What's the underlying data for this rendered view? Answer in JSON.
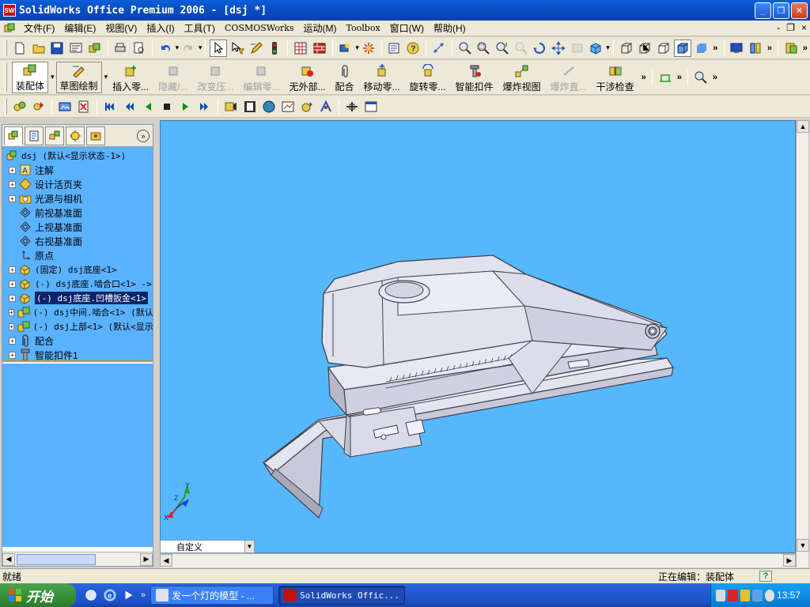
{
  "window": {
    "title": "SolidWorks Office Premium 2006 - [dsj *]",
    "buttons": {
      "minimize": "_",
      "restore": "❐",
      "close": "✕"
    }
  },
  "menubar": {
    "items": [
      "文件(F)",
      "编辑(E)",
      "视图(V)",
      "插入(I)",
      "工具(T)",
      "COSMOSWorks",
      "运动(M)",
      "Toolbox",
      "窗口(W)",
      "帮助(H)"
    ],
    "doc_buttons": {
      "minimize": "-",
      "restore": "❐",
      "close": "×"
    }
  },
  "assembly_toolbar": {
    "buttons": [
      {
        "label": "装配体",
        "enabled": true
      },
      {
        "label": "草图绘制",
        "enabled": true
      },
      {
        "label": "插入零...",
        "enabled": true
      },
      {
        "label": "隐藏/...",
        "enabled": false
      },
      {
        "label": "改变压...",
        "enabled": false
      },
      {
        "label": "编辑零...",
        "enabled": false
      },
      {
        "label": "无外部...",
        "enabled": true
      },
      {
        "label": "配合",
        "enabled": true
      },
      {
        "label": "移动零...",
        "enabled": true
      },
      {
        "label": "旋转零...",
        "enabled": true
      },
      {
        "label": "智能扣件",
        "enabled": true
      },
      {
        "label": "爆炸视图",
        "enabled": true
      },
      {
        "label": "爆炸直...",
        "enabled": false
      },
      {
        "label": "干涉检查",
        "enabled": true
      }
    ]
  },
  "feature_manager": {
    "tree": [
      {
        "label": "dsj  (默认<显示状态-1>)",
        "expander": "",
        "icon": "assembly-icon",
        "indent": 0,
        "mono": true
      },
      {
        "label": "注解",
        "expander": "+",
        "icon": "annotation-icon",
        "indent": 1
      },
      {
        "label": "设计活页夹",
        "expander": "+",
        "icon": "design-binder-icon",
        "indent": 1
      },
      {
        "label": "光源与相机",
        "expander": "+",
        "icon": "lights-camera-icon",
        "indent": 1
      },
      {
        "label": "前视基准面",
        "expander": "",
        "icon": "plane-icon",
        "indent": 1
      },
      {
        "label": "上视基准面",
        "expander": "",
        "icon": "plane-icon",
        "indent": 1
      },
      {
        "label": "右视基准面",
        "expander": "",
        "icon": "plane-icon",
        "indent": 1
      },
      {
        "label": "原点",
        "expander": "",
        "icon": "origin-icon",
        "indent": 1
      },
      {
        "label": "(固定) dsj底座<1>",
        "expander": "+",
        "icon": "part-icon",
        "indent": 1,
        "mono": true
      },
      {
        "label": "(-) dsj底座.啮合口<1> ->",
        "expander": "+",
        "icon": "part-icon",
        "indent": 1,
        "mono": true
      },
      {
        "label": "(-) dsj底座.凹槽扳金<1>",
        "expander": "+",
        "icon": "part-icon",
        "indent": 1,
        "mono": true,
        "selected": true
      },
      {
        "label": "(-) dsj中间.啮合<1> (默认",
        "expander": "+",
        "icon": "subassembly-icon",
        "indent": 1,
        "mono": true
      },
      {
        "label": "(-) dsj上部<1> (默认<显示",
        "expander": "+",
        "icon": "subassembly-icon",
        "indent": 1,
        "mono": true
      },
      {
        "label": "配合",
        "expander": "+",
        "icon": "mates-icon",
        "indent": 1
      },
      {
        "label": "智能扣件1",
        "expander": "+",
        "icon": "smart-fastener-icon",
        "indent": 1
      }
    ]
  },
  "viewport": {
    "configuration": "自定义",
    "triad": {
      "x": "X",
      "y": "Y",
      "z": "Z"
    },
    "background_color": "#55b8fb"
  },
  "statusbar": {
    "left": "就绪",
    "right": "正在编辑：装配体",
    "help": "?"
  },
  "taskbar": {
    "start": "开始",
    "tasks": [
      {
        "label": "发一个灯的模型 - ...",
        "active": false
      },
      {
        "label": "SolidWorks Offic...",
        "active": true
      }
    ],
    "clock": "13:57"
  }
}
